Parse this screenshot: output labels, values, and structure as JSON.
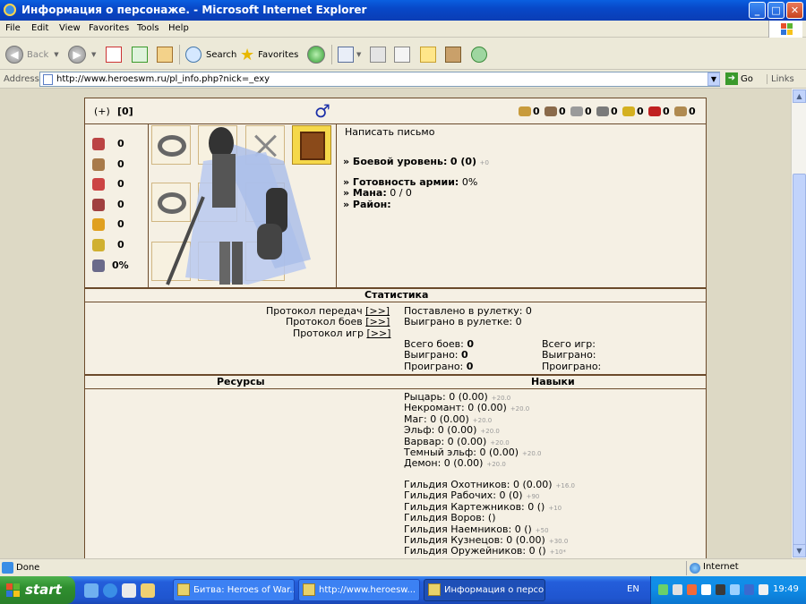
{
  "window": {
    "title": "Информация о персонаже. - Microsoft Internet Explorer",
    "min": "_",
    "max": "□",
    "close": "✕"
  },
  "menu": [
    "File",
    "Edit",
    "View",
    "Favorites",
    "Tools",
    "Help"
  ],
  "toolbar": {
    "back": "Back",
    "search": "Search",
    "favorites": "Favorites"
  },
  "address": {
    "label": "Address",
    "url": "http://www.heroeswm.ru/pl_info.php?nick=_exy",
    "go": "Go",
    "links": "Links"
  },
  "page": {
    "header_left": {
      "plus": "(+)",
      "level_tag": "[0]",
      "gender_symbol": "♂"
    },
    "resources": [
      {
        "icon": "wood-icon",
        "value": "0",
        "color": "#c89b3c"
      },
      {
        "icon": "ore-icon",
        "value": "0",
        "color": "#8a6a4a"
      },
      {
        "icon": "mercury-icon",
        "value": "0",
        "color": "#9a9a9a"
      },
      {
        "icon": "sulfur-icon",
        "value": "0",
        "color": "#7a7a7a"
      },
      {
        "icon": "crystal-icon",
        "value": "0",
        "color": "#d4b020"
      },
      {
        "icon": "gem-icon",
        "value": "0",
        "color": "#c02020"
      },
      {
        "icon": "gold-icon",
        "value": "0",
        "color": "#b08a50"
      }
    ],
    "left_stats": [
      {
        "icon": "attack-icon",
        "value": "0"
      },
      {
        "icon": "defense-icon",
        "value": "0"
      },
      {
        "icon": "spellpower-icon",
        "value": "0"
      },
      {
        "icon": "knowledge-icon",
        "value": "0"
      },
      {
        "icon": "luck-icon",
        "value": "0"
      },
      {
        "icon": "morale-icon",
        "value": "0"
      },
      {
        "icon": "health-icon",
        "value": "0%"
      }
    ],
    "info": {
      "write_letter": "Написать письмо",
      "combat_level_label": "» Боевой уровень:",
      "combat_level_value": "0 (0)",
      "combat_level_small": "+0",
      "army_label": "» Готовность армии:",
      "army_value": "0%",
      "mana_label": "» Мана:",
      "mana_value": "0 / 0",
      "district_label": "» Район:"
    },
    "stats_title": "Статистика",
    "protocols": {
      "transfers": "Протокол передач",
      "battles": "Протокол боев",
      "games": "Протокол игр",
      "link": "[>>]"
    },
    "roulette": {
      "bet": "Поставлено в рулетку: 0",
      "won": "Выиграно в рулетке: 0"
    },
    "battles": {
      "total_label": "Всего боев:",
      "total": "0",
      "won_label": "Выиграно:",
      "won": "0",
      "lost_label": "Проиграно:",
      "lost": "0"
    },
    "games": {
      "total": "Всего игр:",
      "won": "Выиграно:",
      "lost": "Проиграно:"
    },
    "resources_title": "Ресурсы",
    "skills_title": "Навыки",
    "factions": [
      {
        "text": "Рыцарь: 0 (0.00)",
        "small": "+20.0"
      },
      {
        "text": "Некромант: 0 (0.00)",
        "small": "+20.0"
      },
      {
        "text": "Маг: 0 (0.00)",
        "small": "+20.0"
      },
      {
        "text": "Эльф: 0 (0.00)",
        "small": "+20.0"
      },
      {
        "text": "Варвар: 0 (0.00)",
        "small": "+20.0"
      },
      {
        "text": "Темный эльф: 0 (0.00)",
        "small": "+20.0"
      },
      {
        "text": "Демон: 0 (0.00)",
        "small": "+20.0"
      }
    ],
    "guilds": [
      {
        "text": "Гильдия Охотников: 0 (0.00)",
        "small": "+16.0"
      },
      {
        "text": "Гильдия Рабочих: 0 (0)",
        "small": "+90"
      },
      {
        "text": "Гильдия Картежников: 0 ()",
        "small": "+10"
      },
      {
        "text": "Гильдия Воров: ()",
        "small": ""
      },
      {
        "text": "Гильдия Наемников: 0 ()",
        "small": "+50"
      },
      {
        "text": "Гильдия Кузнецов: 0 (0.00)",
        "small": "+30.0"
      },
      {
        "text": "Гильдия Оружейников: 0 ()",
        "small": "+10*"
      }
    ]
  },
  "status": {
    "text": "Done",
    "zone": "Internet"
  },
  "taskbar": {
    "start": "start",
    "tasks": [
      "Битва: Heroes of War...",
      "http://www.heroesw...",
      "Информация о персо..."
    ],
    "lang": "EN",
    "clock": "19:49"
  }
}
